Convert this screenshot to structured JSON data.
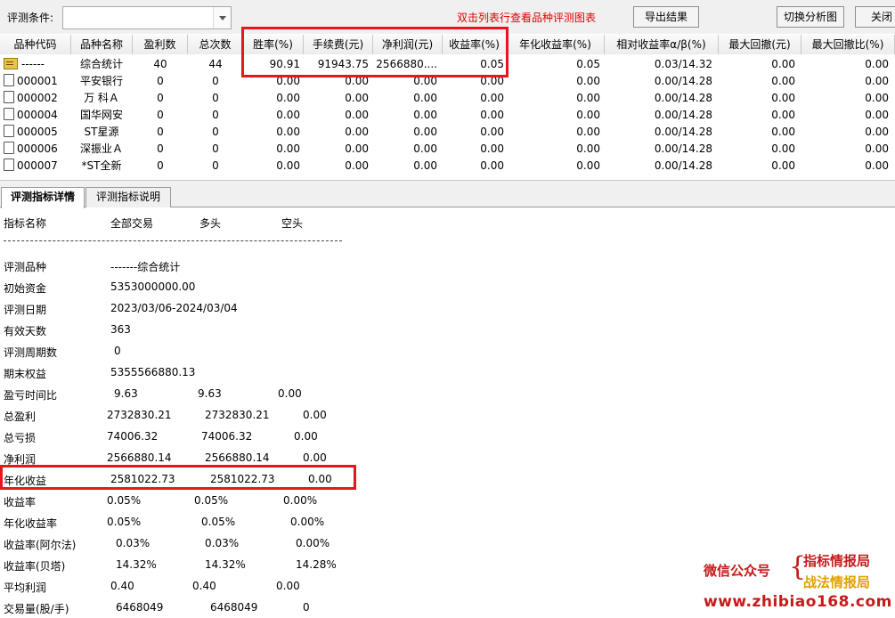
{
  "toolbar": {
    "condition_label": "评测条件:",
    "condition_value": "",
    "hint": "双击列表行查看品种评测图表",
    "export_label": "导出结果",
    "switch_label": "切换分析图",
    "close_label": "关闭"
  },
  "grid": {
    "headers": [
      "品种代码",
      "品种名称",
      "盈利数",
      "总次数",
      "胜率(%)",
      "手续费(元)",
      "净利润(元)",
      "收益率(%)",
      "年化收益率(%)",
      "相对收益率α/β(%)",
      "最大回撤(元)",
      "最大回撤比(%)"
    ],
    "rows": [
      {
        "code": "------",
        "name": "综合统计",
        "wins": "40",
        "total": "44",
        "winrate": "90.91",
        "fee": "91943.75",
        "profit": "2566880....",
        "ret": "0.05",
        "annual": "0.05",
        "rel": "0.03/14.32",
        "maxdd": "0.00",
        "maxddr": "0.00"
      },
      {
        "code": "000001",
        "name": "平安银行",
        "wins": "0",
        "total": "0",
        "winrate": "0.00",
        "fee": "0.00",
        "profit": "0.00",
        "ret": "0.00",
        "annual": "0.00",
        "rel": "0.00/14.28",
        "maxdd": "0.00",
        "maxddr": "0.00"
      },
      {
        "code": "000002",
        "name": "万 科Ａ",
        "wins": "0",
        "total": "0",
        "winrate": "0.00",
        "fee": "0.00",
        "profit": "0.00",
        "ret": "0.00",
        "annual": "0.00",
        "rel": "0.00/14.28",
        "maxdd": "0.00",
        "maxddr": "0.00"
      },
      {
        "code": "000004",
        "name": "国华网安",
        "wins": "0",
        "total": "0",
        "winrate": "0.00",
        "fee": "0.00",
        "profit": "0.00",
        "ret": "0.00",
        "annual": "0.00",
        "rel": "0.00/14.28",
        "maxdd": "0.00",
        "maxddr": "0.00"
      },
      {
        "code": "000005",
        "name": "ST星源",
        "wins": "0",
        "total": "0",
        "winrate": "0.00",
        "fee": "0.00",
        "profit": "0.00",
        "ret": "0.00",
        "annual": "0.00",
        "rel": "0.00/14.28",
        "maxdd": "0.00",
        "maxddr": "0.00"
      },
      {
        "code": "000006",
        "name": "深振业Ａ",
        "wins": "0",
        "total": "0",
        "winrate": "0.00",
        "fee": "0.00",
        "profit": "0.00",
        "ret": "0.00",
        "annual": "0.00",
        "rel": "0.00/14.28",
        "maxdd": "0.00",
        "maxddr": "0.00"
      },
      {
        "code": "000007",
        "name": "*ST全新",
        "wins": "0",
        "total": "0",
        "winrate": "0.00",
        "fee": "0.00",
        "profit": "0.00",
        "ret": "0.00",
        "annual": "0.00",
        "rel": "0.00/14.28",
        "maxdd": "0.00",
        "maxddr": "0.00"
      }
    ]
  },
  "tabs": {
    "details_label": "评测指标详情",
    "explain_label": "评测指标说明"
  },
  "details": {
    "header": [
      "指标名称",
      "全部交易",
      "多头",
      "空头"
    ],
    "rows": [
      {
        "name": "评测品种",
        "all": "-------综合统计",
        "long": "",
        "short": ""
      },
      {
        "name": "初始资金",
        "all": "5353000000.00",
        "long": "",
        "short": ""
      },
      {
        "name": "评测日期",
        "all": "2023/03/06-2024/03/04",
        "long": "",
        "short": ""
      },
      {
        "name": "有效天数",
        "all": "363",
        "long": "",
        "short": ""
      },
      {
        "name": "评测周期数",
        "all": "0",
        "long": "",
        "short": ""
      },
      {
        "name": "期末权益",
        "all": "5355566880.13",
        "long": "",
        "short": ""
      },
      {
        "name": "盈亏时间比",
        "all": "9.63",
        "long": "9.63",
        "short": "0.00"
      },
      {
        "name": "总盈利",
        "all": "2732830.21",
        "long": "2732830.21",
        "short": "0.00"
      },
      {
        "name": "总亏损",
        "all": "74006.32",
        "long": "74006.32",
        "short": "0.00"
      },
      {
        "name": "净利润",
        "all": "2566880.14",
        "long": "2566880.14",
        "short": "0.00"
      },
      {
        "name": "年化收益",
        "all": "2581022.73",
        "long": "2581022.73",
        "short": "0.00"
      },
      {
        "name": "收益率",
        "all": "0.05%",
        "long": "0.05%",
        "short": "0.00%"
      },
      {
        "name": "年化收益率",
        "all": "0.05%",
        "long": "0.05%",
        "short": "0.00%"
      },
      {
        "name": "收益率(阿尔法)",
        "all": "0.03%",
        "long": "0.03%",
        "short": "0.00%"
      },
      {
        "name": "收益率(贝塔)",
        "all": "14.32%",
        "long": "14.32%",
        "short": "14.28%"
      },
      {
        "name": "平均利润",
        "all": "0.40",
        "long": "0.40",
        "short": "0.00"
      },
      {
        "name": "交易量(股/手)",
        "all": "6468049",
        "long": "6468049",
        "short": "0"
      }
    ]
  },
  "watermark": {
    "wechat": "微信公众号",
    "line1": "指标情报局",
    "line2": "战法情报局",
    "url": "www.zhibiao168.com"
  },
  "colors": {
    "highlight": "#e8141e",
    "hint": "#e00000"
  }
}
